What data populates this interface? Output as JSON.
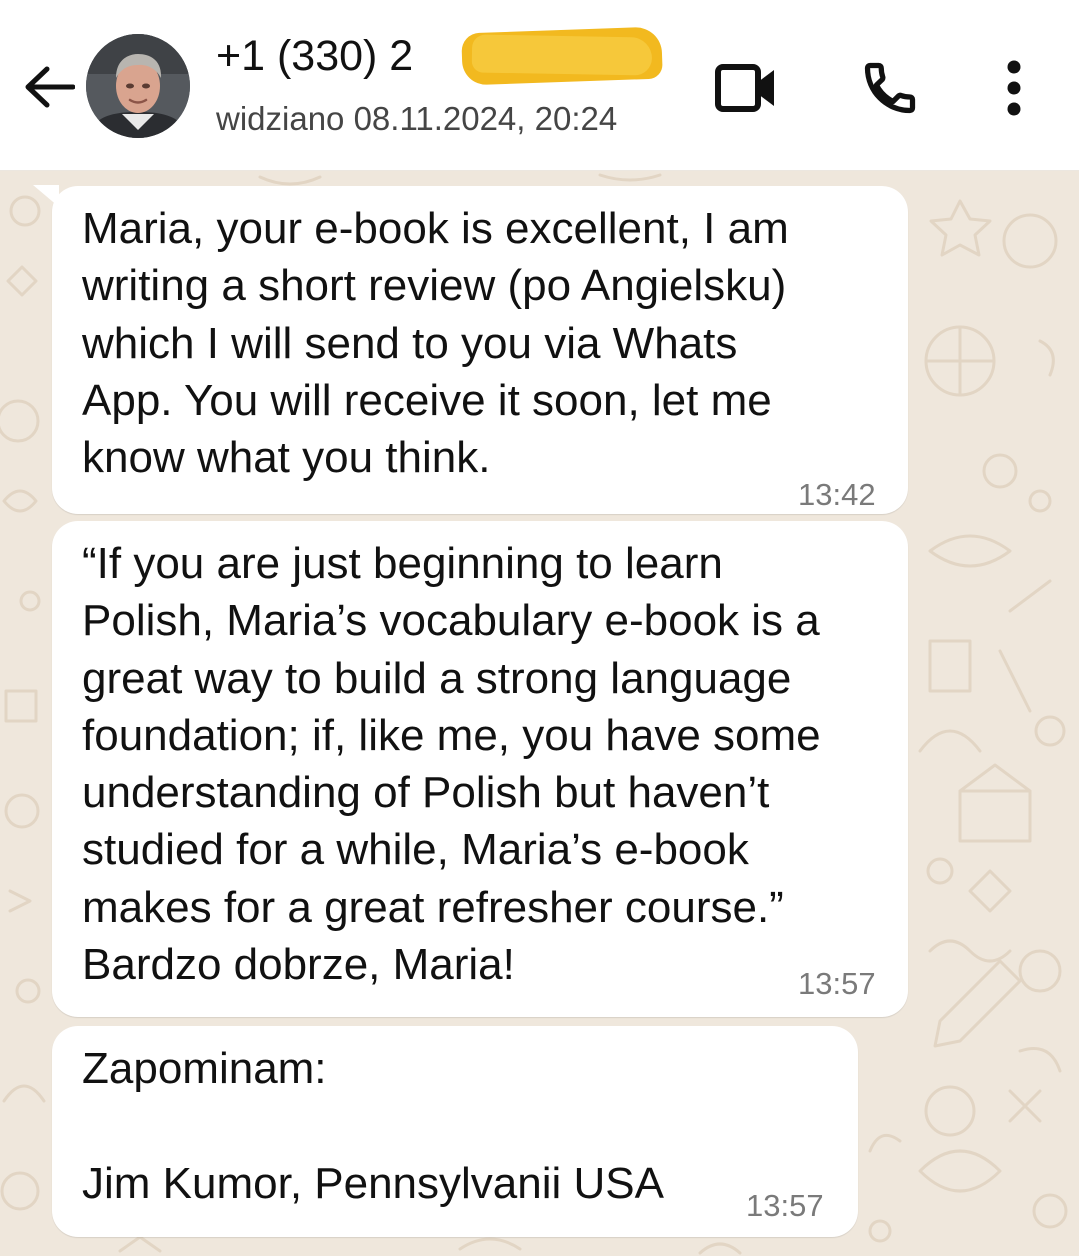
{
  "header": {
    "contact_name": "+1 (330) 2",
    "last_seen": "widziano 08.11.2024, 20:24",
    "icons": {
      "back": "arrow-left-icon",
      "video": "video-camera-icon",
      "call": "phone-icon",
      "menu": "more-vertical-icon"
    }
  },
  "messages": [
    {
      "text": "Maria, your e-book is excellent, I am\nwriting a short review (po Angielsku)\nwhich I will send to you via Whats\nApp. You will receive it soon, let me\nknow what you think.",
      "time": "13:42"
    },
    {
      "text": "“If you are just beginning to learn\nPolish, Maria’s vocabulary e-book is a\ngreat way to build a strong language\nfoundation; if, like me, you have some\nunderstanding of Polish but haven’t\nstudied for a while, Maria’s e-book\nmakes for a great refresher course.”\nBardzo dobrze, Maria!",
      "time": "13:57"
    },
    {
      "text": "Zapominam:\n\nJim Kumor, Pennsylvanii USA",
      "time": "13:57"
    }
  ],
  "colors": {
    "chat_background": "#efe7dc",
    "bubble": "#ffffff",
    "redaction": "#f2b91f",
    "timestamp": "#7a7a7a"
  }
}
